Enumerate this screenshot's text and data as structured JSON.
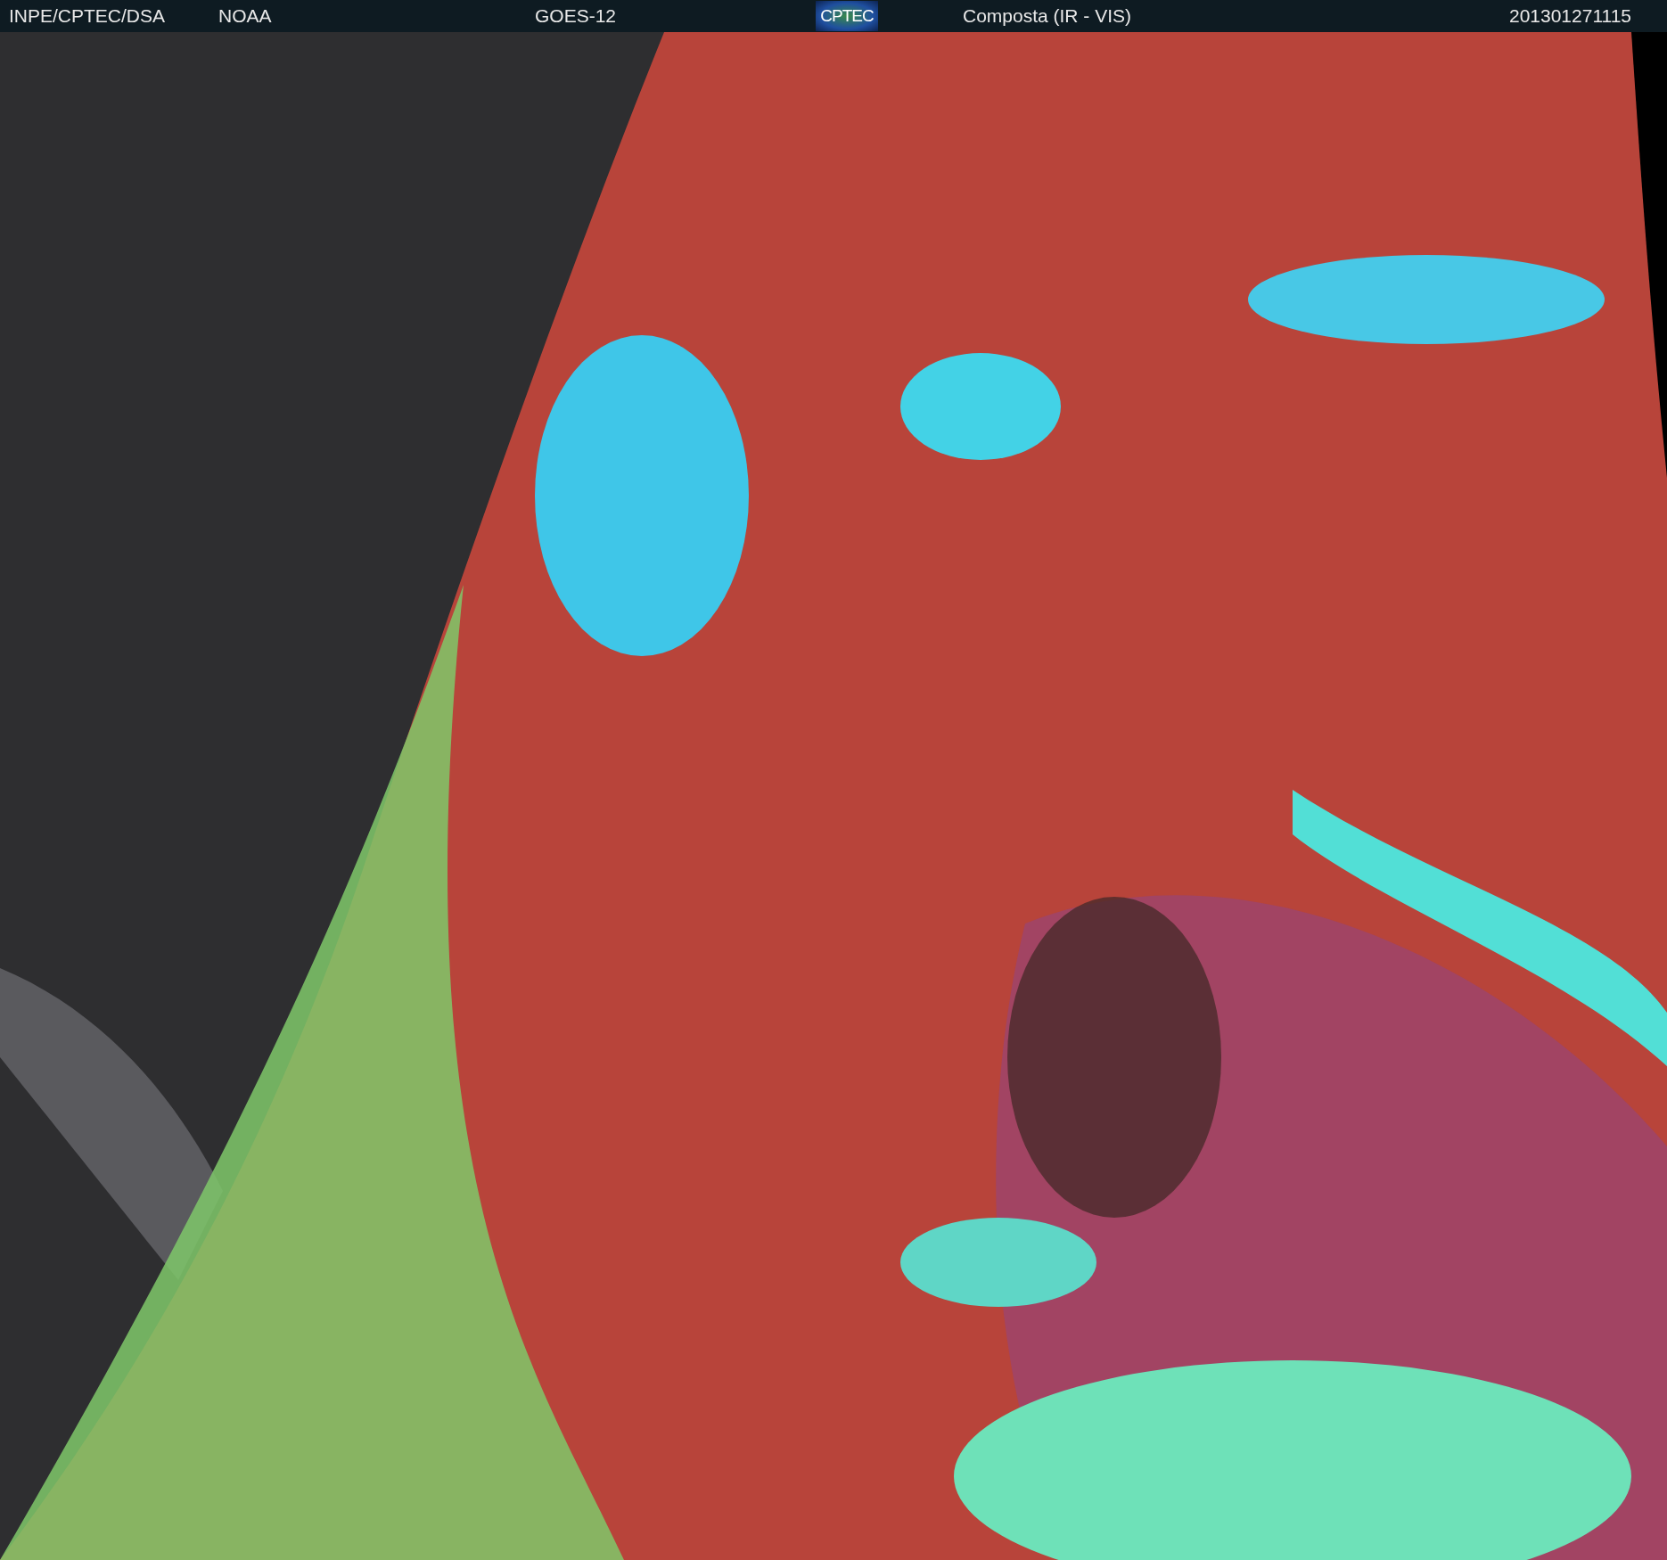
{
  "header": {
    "source": "INPE/CPTEC/DSA",
    "agency": "NOAA",
    "satellite": "GOES-12",
    "logo": "CPTEC",
    "product": "Composta (IR - VIS)",
    "timestamp": "201301271115"
  }
}
